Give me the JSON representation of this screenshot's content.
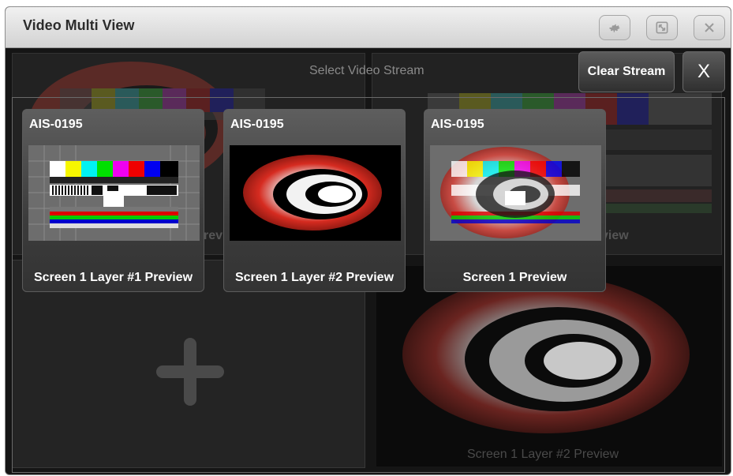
{
  "window": {
    "title": "Video Multi View"
  },
  "titlebar_buttons": [
    {
      "name": "settings-button",
      "icon": "gear-icon"
    },
    {
      "name": "fullscreen-button",
      "icon": "expand-icon"
    },
    {
      "name": "close-window-button",
      "icon": "close-icon"
    }
  ],
  "header": {
    "select_stream": "Select Video Stream",
    "clear_stream": "Clear Stream",
    "close": "X"
  },
  "streams": [
    {
      "title": "AIS-0195",
      "label": "Screen 1 Layer #1 Preview",
      "thumbnail": "test-pattern"
    },
    {
      "title": "AIS-0195",
      "label": "Screen 1 Layer #2 Preview",
      "thumbnail": "swirl-logo"
    },
    {
      "title": "AIS-0195",
      "label": "Screen 1 Preview",
      "thumbnail": "test-pattern-with-logo"
    }
  ],
  "background": {
    "bl_pane": "empty-slot",
    "br_label": "Screen 1 Layer #2 Preview",
    "tl_fragment": "rev",
    "tr_fragment": "view"
  },
  "colors": {
    "card_bg": "#4a4a4a",
    "logo_red": "#d62b20",
    "text": "#ffffff"
  }
}
